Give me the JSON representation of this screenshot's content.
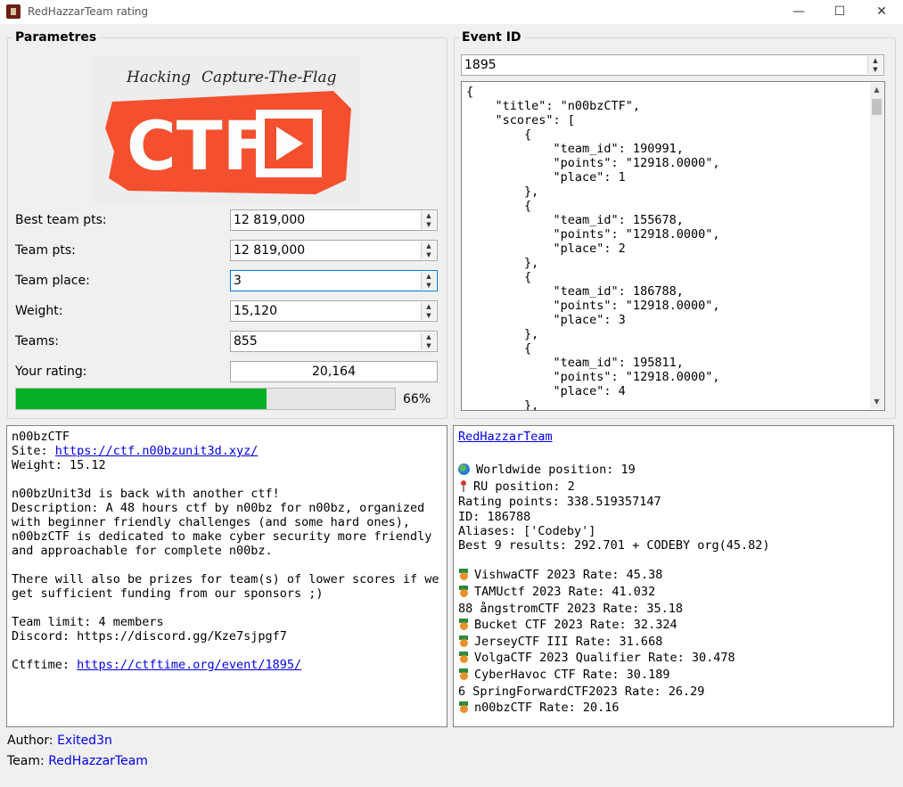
{
  "window": {
    "title": "RedHazzarTeam rating",
    "minimize_glyph": "—",
    "maximize_glyph": "☐",
    "close_glyph": "✕"
  },
  "params": {
    "group_title": "Parametres",
    "logo": {
      "top_text": "Hacking Capture-The-Flag",
      "main_text": "CTF",
      "brand_color": "#f4502f"
    },
    "best_team_pts": {
      "label": "Best team pts:",
      "value": "12 819,000"
    },
    "team_pts": {
      "label": "Team pts:",
      "value": "12 819,000"
    },
    "team_place": {
      "label": "Team place:",
      "value": "3"
    },
    "weight": {
      "label": "Weight:",
      "value": "15,120"
    },
    "teams": {
      "label": "Teams:",
      "value": "855"
    },
    "your_rating": {
      "label": "Your rating:",
      "value": "20,164"
    },
    "progress": {
      "value": 0.66,
      "label": "66%",
      "color": "#06b025"
    }
  },
  "event": {
    "group_title": "Event ID",
    "id_value": "1895",
    "json_text": "{\n    \"title\": \"n00bzCTF\",\n    \"scores\": [\n        {\n            \"team_id\": 190991,\n            \"points\": \"12918.0000\",\n            \"place\": 1\n        },\n        {\n            \"team_id\": 155678,\n            \"points\": \"12918.0000\",\n            \"place\": 2\n        },\n        {\n            \"team_id\": 186788,\n            \"points\": \"12918.0000\",\n            \"place\": 3\n        },\n        {\n            \"team_id\": 195811,\n            \"points\": \"12918.0000\",\n            \"place\": 4\n        },"
  },
  "event_info": {
    "name": "n00bzCTF",
    "site_prefix": "Site: ",
    "site_url": "https://ctf.n00bzunit3d.xyz/",
    "weight": "Weight: 15.12",
    "lines": [
      "n00bzUnit3d is back with another ctf!",
      "Description: A 48 hours ctf by n00bz for n00bz, organized",
      "with beginner friendly challenges (and some hard ones),",
      "n00bzCTF is dedicated to make cyber security more friendly",
      "and approachable for complete n00bz."
    ],
    "prize_lines": [
      "There will also be prizes for team(s) of lower scores if we",
      "get sufficient funding from our sponsors ;)"
    ],
    "team_limit": "Team limit: 4 members",
    "discord": "Discord: https://discord.gg/Kze7sjpgf7",
    "ctftime_prefix": "Ctftime: ",
    "ctftime_url": "https://ctftime.org/event/1895/"
  },
  "team_info": {
    "name": "RedHazzarTeam",
    "worldwide": "Worldwide position: 19",
    "ru": "RU position: 2",
    "rating_points": "Rating points: 338.519357147",
    "id": "ID: 186788",
    "aliases": "Aliases: ['Codeby']",
    "best": "Best 9 results: 292.701 + CODEBY org(45.82)",
    "results": [
      {
        "icon": "medal",
        "text": "VishwaCTF 2023 Rate: 45.38"
      },
      {
        "icon": "medal",
        "text": "TAMUctf 2023 Rate: 41.032"
      },
      {
        "icon": "",
        "text": "88 ångstromCTF 2023 Rate: 35.18"
      },
      {
        "icon": "medal",
        "text": "Bucket CTF 2023 Rate: 32.324"
      },
      {
        "icon": "medal",
        "text": "JerseyCTF III Rate: 31.668"
      },
      {
        "icon": "medal",
        "text": "VolgaCTF 2023 Qualifier Rate: 30.478"
      },
      {
        "icon": "medal",
        "text": "CyberHavoc CTF Rate: 30.189"
      },
      {
        "icon": "",
        "text": "6 SpringForwardCTF2023 Rate: 26.29"
      },
      {
        "icon": "medal",
        "text": "n00bzCTF Rate: 20.16"
      }
    ]
  },
  "footer": {
    "author_label": "Author:",
    "author_name": "Exited3n",
    "team_label": "Team:",
    "team_name": "RedHazzarTeam"
  }
}
